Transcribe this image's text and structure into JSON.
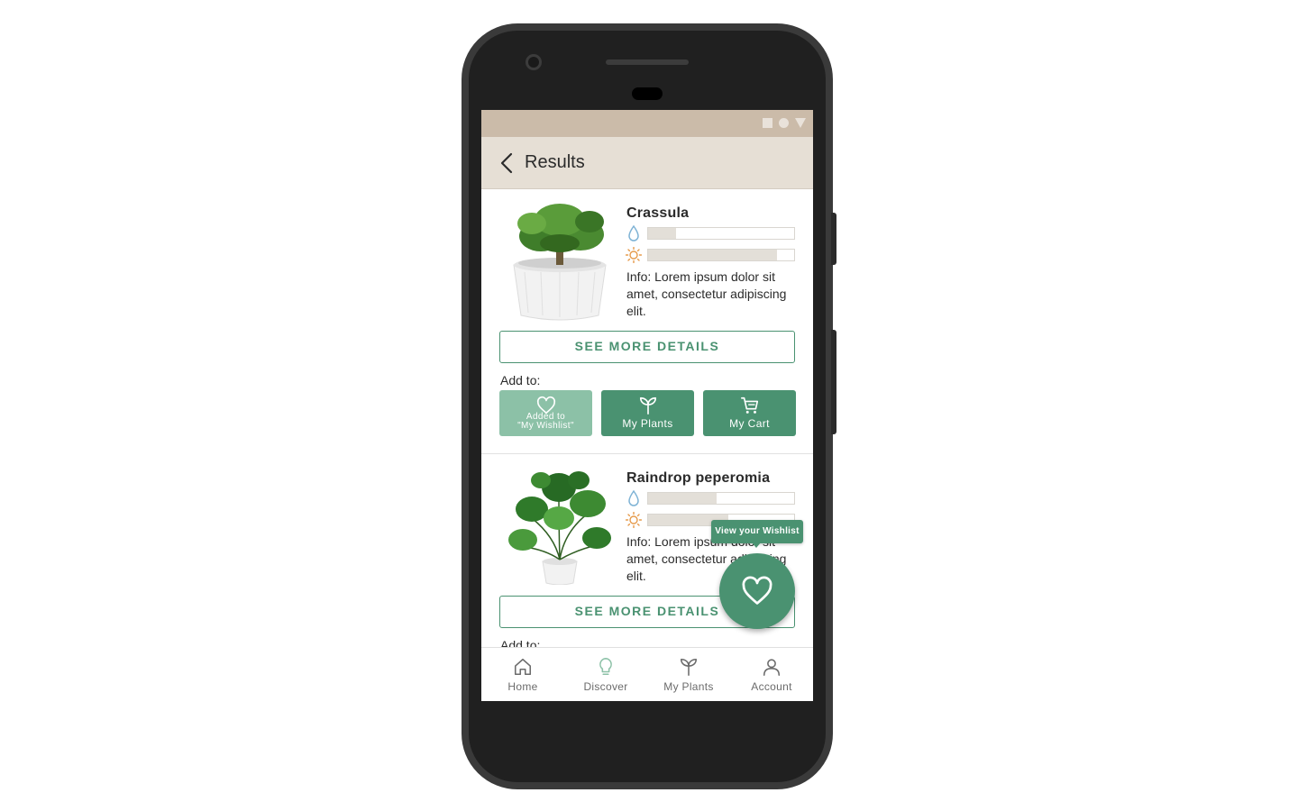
{
  "appbar": {
    "title": "Results"
  },
  "colors": {
    "accent": "#4a9271",
    "accent_light": "#8cc1a7",
    "status_bar": "#cbbba9",
    "app_bar": "#e6dfd5"
  },
  "results": [
    {
      "name": "Crassula",
      "water_level": 0.19,
      "light_level": 0.88,
      "info": "Info: Lorem ipsum dolor sit amet, consectetur adipiscing elit.",
      "details_label": "SEE MORE DETAILS",
      "add_to_label": "Add to:",
      "wishlist_label_line1": "Added to",
      "wishlist_label_line2": "\"My Wishlist\"",
      "plants_label": "My Plants",
      "cart_label": "My Cart"
    },
    {
      "name": "Raindrop peperomia",
      "water_level": 0.47,
      "light_level": 0.55,
      "info": "Info: Lorem ipsum dolor sit amet, consectetur adipiscing elit.",
      "details_label": "SEE MORE DETAILS",
      "add_to_label": "Add to:"
    }
  ],
  "fab": {
    "tooltip": "View your Wishlist",
    "icon": "heart-icon"
  },
  "bottom_nav": [
    {
      "label": "Home",
      "icon": "home-icon"
    },
    {
      "label": "Discover",
      "icon": "lightbulb-icon"
    },
    {
      "label": "My Plants",
      "icon": "sprout-icon"
    },
    {
      "label": "Account",
      "icon": "account-icon"
    }
  ]
}
